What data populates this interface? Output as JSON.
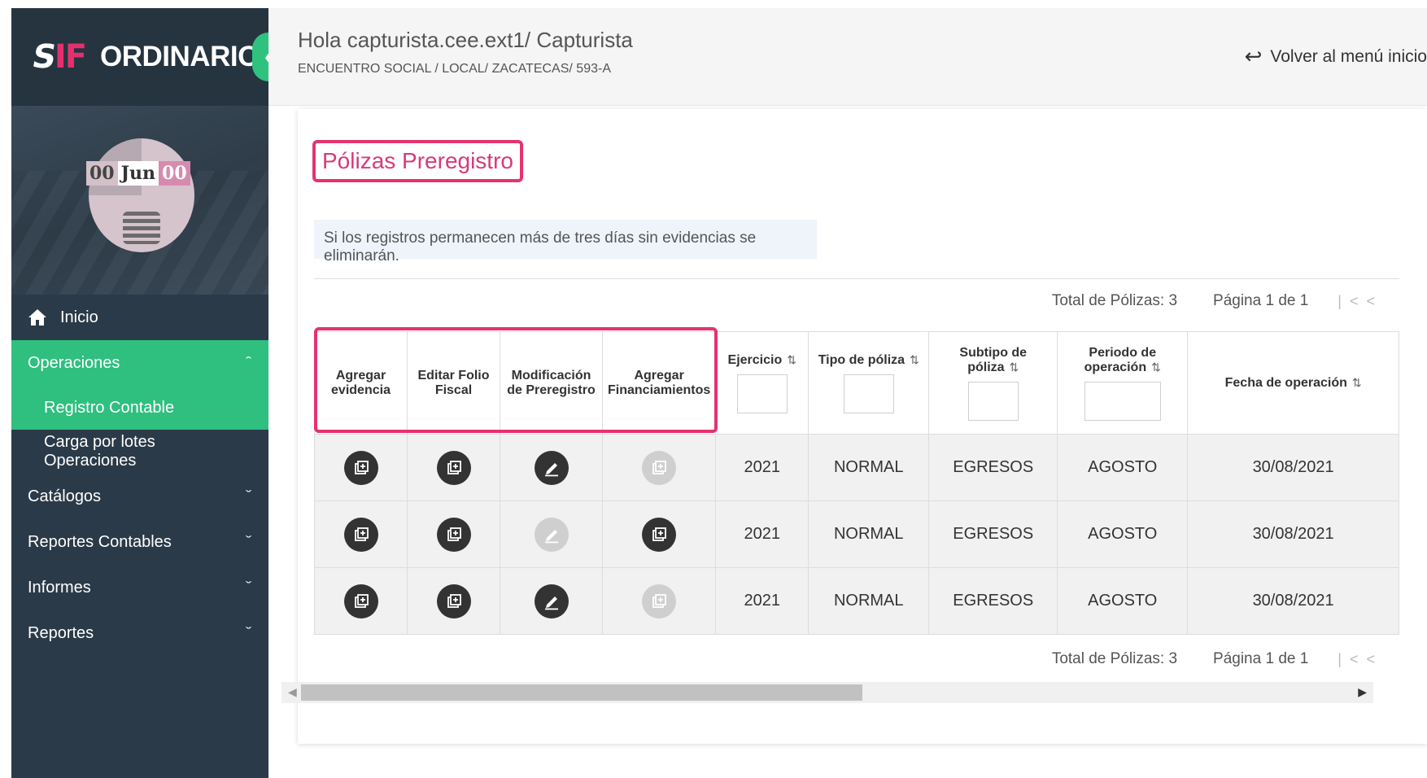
{
  "brand": {
    "title": "ORDINARIO",
    "logo_s": "S",
    "logo_if": "IF"
  },
  "avatar": {
    "day": "00",
    "month": "Jun",
    "year": "00"
  },
  "menu": {
    "inicio": "Inicio",
    "operaciones": "Operaciones",
    "registro_contable": "Registro Contable",
    "carga_lotes": "Carga por lotes Operaciones",
    "catalogos": "Catálogos",
    "reportes_contables": "Reportes Contables",
    "informes": "Informes",
    "reportes": "Reportes"
  },
  "header": {
    "greeting": "Hola capturista.cee.ext1/ Capturista",
    "subtitle": "ENCUENTRO SOCIAL / LOCAL/ ZACATECAS/ 593-A",
    "back_label": "Volver al menú inicio"
  },
  "page": {
    "title": "Pólizas Preregistro",
    "notice": "Si los registros permanecen más de tres días sin evidencias se eliminarán."
  },
  "pager": {
    "total": "Total de Pólizas: 3",
    "page": "Página 1 de 1"
  },
  "columns": {
    "agregar_evidencia": "Agregar evidencia",
    "editar_folio": "Editar Folio Fiscal",
    "modificacion": "Modificación de Preregistro",
    "agregar_fin": "Agregar Financiamientos",
    "ejercicio": "Ejercicio",
    "tipo_poliza": "Tipo de póliza",
    "subtipo_poliza": "Subtipo de póliza",
    "periodo": "Periodo de operación",
    "fecha": "Fecha de operación"
  },
  "rows": [
    {
      "ejercicio": "2021",
      "tipo": "NORMAL",
      "subtipo": "EGRESOS",
      "periodo": "AGOSTO",
      "fecha": "30/08/2021",
      "edit_enabled": true,
      "fin_enabled": false
    },
    {
      "ejercicio": "2021",
      "tipo": "NORMAL",
      "subtipo": "EGRESOS",
      "periodo": "AGOSTO",
      "fecha": "30/08/2021",
      "edit_enabled": false,
      "fin_enabled": true
    },
    {
      "ejercicio": "2021",
      "tipo": "NORMAL",
      "subtipo": "EGRESOS",
      "periodo": "AGOSTO",
      "fecha": "30/08/2021",
      "edit_enabled": true,
      "fin_enabled": false
    }
  ],
  "colors": {
    "accent_green": "#2fbf7f",
    "highlight_pink": "#e5336e",
    "sidebar_bg": "#2b3a48"
  }
}
